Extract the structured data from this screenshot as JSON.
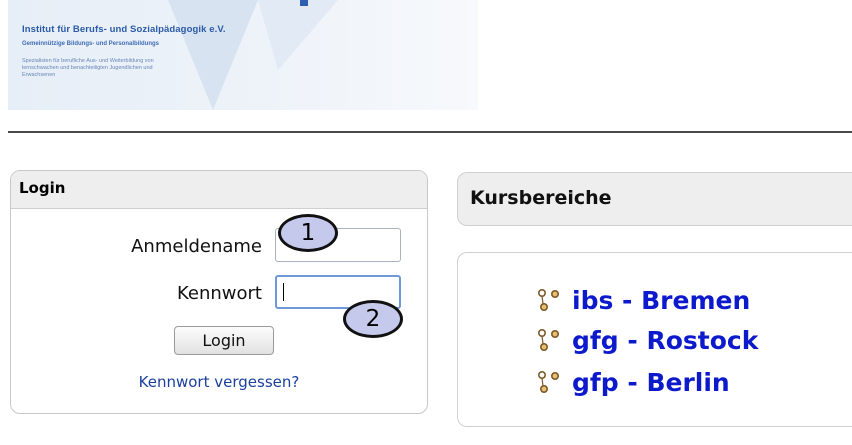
{
  "header": {
    "org_name": "Institut für Berufs- und Sozialpädagogik e.V.",
    "org_sub": "Gemeinnützige Bildungs- und Personalbildungs",
    "org_desc": "Spezialisten für berufliche Aus- und Weiterbildung von lernschwachen und benachteiligten Jugendlichen und Erwachsenen"
  },
  "login": {
    "title": "Login",
    "username_label": "Anmeldename",
    "username_value": "",
    "password_label": "Kennwort",
    "password_value": "",
    "login_button": "Login",
    "forgot_link": "Kennwort vergessen?"
  },
  "callouts": [
    "1",
    "2"
  ],
  "courses": {
    "title": "Kursbereiche",
    "items": [
      {
        "label": "ibs - Bremen",
        "icon": "category-icon"
      },
      {
        "label": "gfg - Rostock",
        "icon": "category-icon"
      },
      {
        "label": "gfp - Berlin",
        "icon": "category-icon"
      }
    ]
  },
  "colors": {
    "link": "#1a3f9c",
    "course_link": "#0c1acc",
    "callout_fill": "#c5c9ec",
    "header_bg": "#eeeeee",
    "input_focus": "#6f98d8"
  }
}
